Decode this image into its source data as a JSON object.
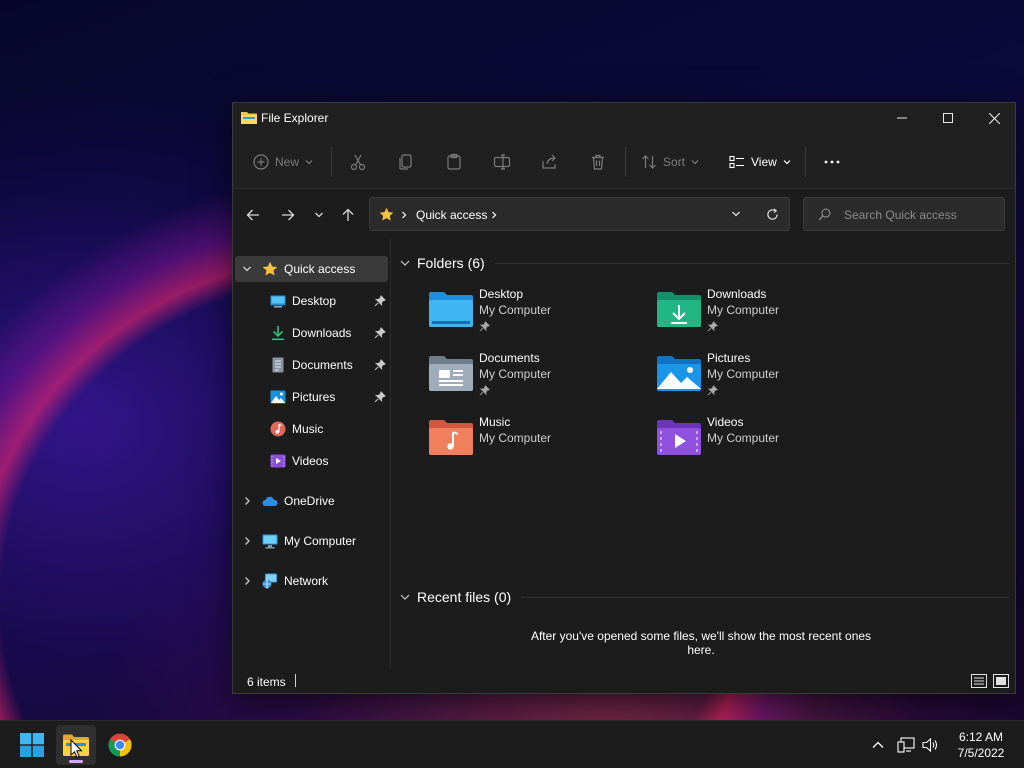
{
  "window": {
    "title": "File Explorer"
  },
  "toolbar": {
    "new_label": "New",
    "sort_label": "Sort",
    "view_label": "View"
  },
  "address": {
    "path_label": "Quick access",
    "search_placeholder": "Search Quick access"
  },
  "sidebar": {
    "quick_access": "Quick access",
    "pinned": [
      {
        "label": "Desktop",
        "icon": "desktop-icon"
      },
      {
        "label": "Downloads",
        "icon": "download-icon"
      },
      {
        "label": "Documents",
        "icon": "document-icon"
      },
      {
        "label": "Pictures",
        "icon": "picture-icon"
      },
      {
        "label": "Music",
        "icon": "music-icon"
      },
      {
        "label": "Videos",
        "icon": "video-icon"
      }
    ],
    "onedrive": "OneDrive",
    "my_computer": "My Computer",
    "network": "Network"
  },
  "folders": {
    "title": "Folders (6)",
    "items": [
      {
        "name": "Desktop",
        "location": "My Computer",
        "pinned": true
      },
      {
        "name": "Downloads",
        "location": "My Computer",
        "pinned": true
      },
      {
        "name": "Documents",
        "location": "My Computer",
        "pinned": true
      },
      {
        "name": "Pictures",
        "location": "My Computer",
        "pinned": true
      },
      {
        "name": "Music",
        "location": "My Computer",
        "pinned": false
      },
      {
        "name": "Videos",
        "location": "My Computer",
        "pinned": false
      }
    ]
  },
  "recent": {
    "title": "Recent files (0)",
    "empty_message": "After you've opened some files, we'll show the most recent ones here."
  },
  "status": {
    "items_count": "6 items"
  },
  "taskbar": {
    "time": "6:12 AM",
    "date": "7/5/2022"
  },
  "colors": {
    "accent": "#60cdff",
    "folder_yellow": "#f5c242",
    "selected_bg": "#3a3a3a"
  }
}
